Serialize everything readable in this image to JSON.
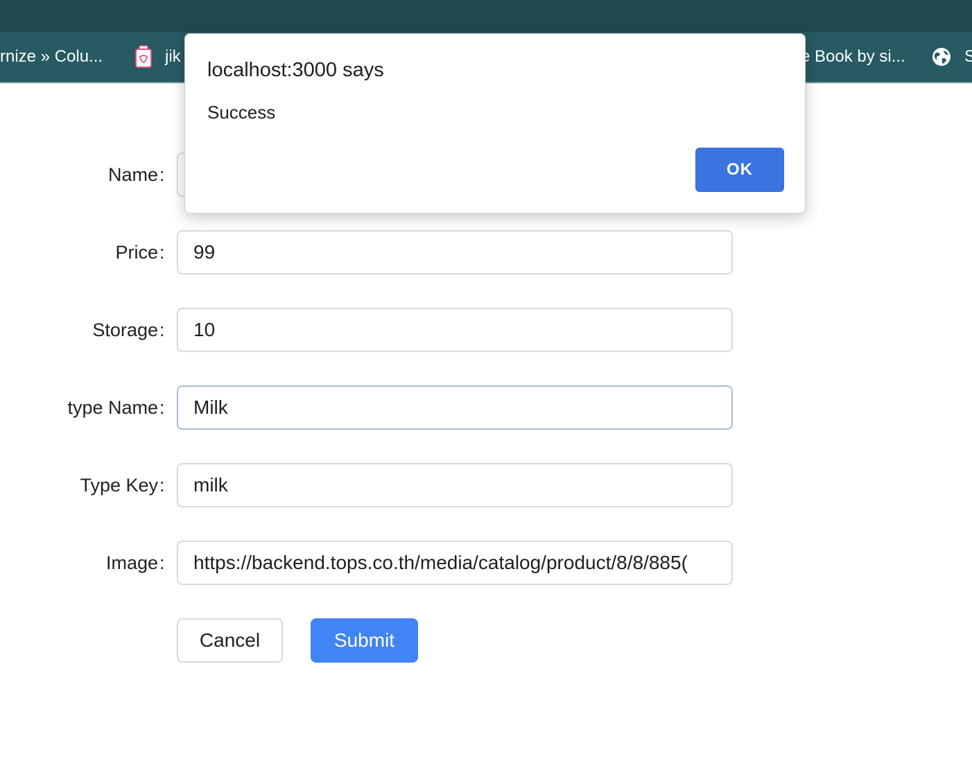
{
  "bookmarks": [
    {
      "label": "rnize » Colu...",
      "icon": "none"
    },
    {
      "label": "jik",
      "icon": "jar-icon"
    },
    {
      "label": "e Book by si...",
      "icon": "none"
    },
    {
      "label": "S",
      "icon": "globe-icon"
    }
  ],
  "form": {
    "name": {
      "label": "Name",
      "colon": ":",
      "value": ""
    },
    "price": {
      "label": "Price",
      "colon": ":",
      "value": "99"
    },
    "storage": {
      "label": "Storage",
      "colon": ":",
      "value": "10"
    },
    "type_name": {
      "label": "type Name",
      "colon": ":",
      "value": "Milk"
    },
    "type_key": {
      "label": "Type Key",
      "colon": ":",
      "value": "milk"
    },
    "image": {
      "label": "Image",
      "colon": ":",
      "value": "https://backend.tops.co.th/media/catalog/product/8/8/885("
    },
    "cancel_label": "Cancel",
    "submit_label": "Submit"
  },
  "dialog": {
    "title": "localhost:3000 says",
    "message": "Success",
    "ok_label": "OK"
  },
  "colors": {
    "top_strip": "#23474f",
    "bookmarks_bar": "#275a63",
    "submit_button": "#4184f3",
    "dialog_ok": "#3b74e0"
  }
}
